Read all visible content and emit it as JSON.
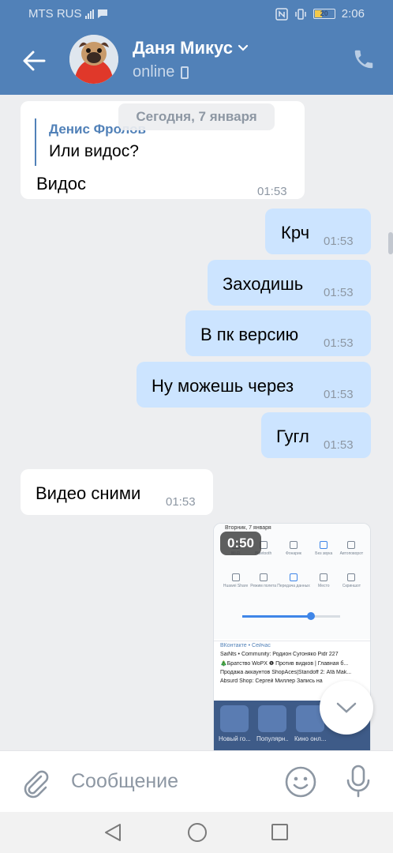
{
  "status_bar": {
    "carrier": "MTS RUS",
    "battery": "20",
    "time": "2:06"
  },
  "header": {
    "name": "Даня Микус",
    "status": "online"
  },
  "chat": {
    "date_separator": "Сегодня, 7 января",
    "messages": [
      {
        "direction": "in",
        "reply_author": "Денис Фролов",
        "reply_text": "Или видос?",
        "text": "Видос",
        "time": "01:53"
      },
      {
        "direction": "out",
        "text": "Крч",
        "time": "01:53"
      },
      {
        "direction": "out",
        "text": "Заходишь",
        "time": "01:53"
      },
      {
        "direction": "out",
        "text": "В пк версию",
        "time": "01:53"
      },
      {
        "direction": "out",
        "text": "Ну можешь через",
        "time": "01:53"
      },
      {
        "direction": "out",
        "text": "Гугл",
        "time": "01:53"
      },
      {
        "direction": "in",
        "text": "Видео сними",
        "time": "01:53"
      }
    ],
    "video": {
      "duration": "0:50",
      "screen_date": "Вторник, 7 января",
      "quick_settings": [
        "Wi-Fi",
        "Bluetooth",
        "Фонарик",
        "Без звука",
        "Автоповорот",
        "Huawei Share",
        "Режим полета",
        "Передача данных",
        "Место",
        "Скриншот"
      ],
      "notification_lines": [
        "ВКонтакте • Сейчас",
        "SaiNts • Community: Родион Сугоняко Pidr 227",
        "🎄Братство WoPX ❶ Против видков | Главная б...",
        "Продажа аккаунтов ShopAces|Standoff 2: Äfä Mak...",
        "Absurd Shop: Сергей Миллер Запись на"
      ],
      "app_labels": [
        "Новый го...",
        "Популярн...",
        "Кино онл..."
      ]
    }
  },
  "input": {
    "placeholder": "Сообщение"
  },
  "colors": {
    "header": "#5181b8",
    "incoming": "#ffffff",
    "outgoing": "#cce4ff",
    "background": "#edeef0"
  },
  "icons": [
    "back-arrow-icon",
    "chevron-down-icon",
    "phone-icon",
    "paperclip-icon",
    "emoji-icon",
    "microphone-icon",
    "scroll-down-chevron-icon"
  ]
}
